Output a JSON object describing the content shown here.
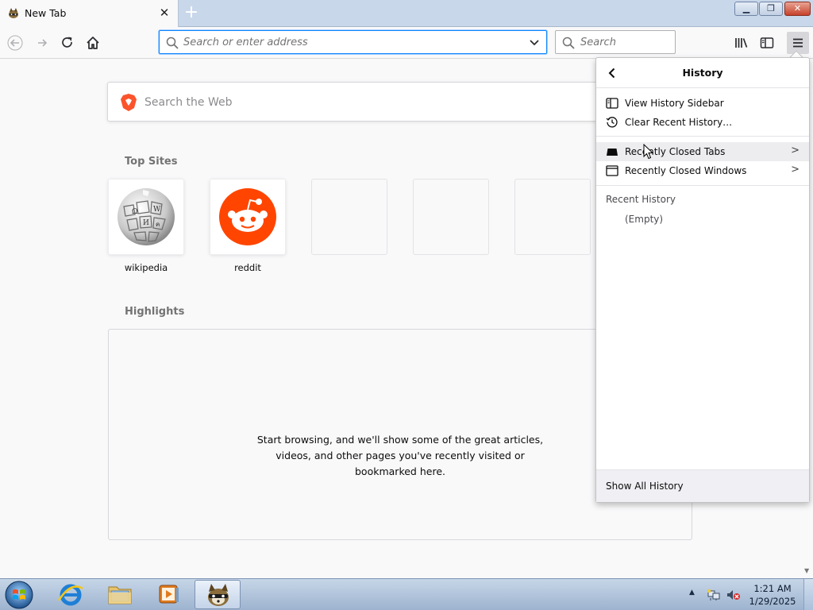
{
  "tab": {
    "title": "New Tab",
    "close_glyph": "✕",
    "favicon": "raccoon-favicon-icon"
  },
  "newtab_glyph": "+",
  "window_controls": {
    "minimize": "▁",
    "maximize": "❐",
    "close": "✕"
  },
  "toolbar": {
    "url_placeholder": "Search or enter address",
    "search_placeholder": "Search"
  },
  "newtab": {
    "websearch_placeholder": "Search the Web",
    "top_sites_title": "Top Sites",
    "top_sites": [
      {
        "label": "wikipedia",
        "icon": "wikipedia-globe-icon"
      },
      {
        "label": "reddit",
        "icon": "reddit-alien-icon"
      },
      {
        "label": ""
      },
      {
        "label": ""
      },
      {
        "label": ""
      }
    ],
    "highlights_title": "Highlights",
    "highlights_empty": "Start browsing, and we'll show some of the great articles, videos, and other pages you've recently visited or bookmarked here."
  },
  "history_panel": {
    "title": "History",
    "items": [
      {
        "label": "View History Sidebar",
        "icon": "sidebar-icon"
      },
      {
        "label": "Clear Recent History…",
        "icon": "history-clock-icon"
      },
      {
        "label": "Recently Closed Tabs",
        "icon": "tab-icon",
        "submenu": true
      },
      {
        "label": "Recently Closed Windows",
        "icon": "window-icon",
        "submenu": true
      }
    ],
    "recent_history_label": "Recent History",
    "recent_history_empty": "(Empty)",
    "footer": "Show All History"
  },
  "taskbar": {
    "time": "1:21 AM",
    "date": "1/29/2025"
  },
  "colors": {
    "accent": "#0a84ff",
    "reddit": "#ff4500",
    "brave": "#fb542b"
  }
}
